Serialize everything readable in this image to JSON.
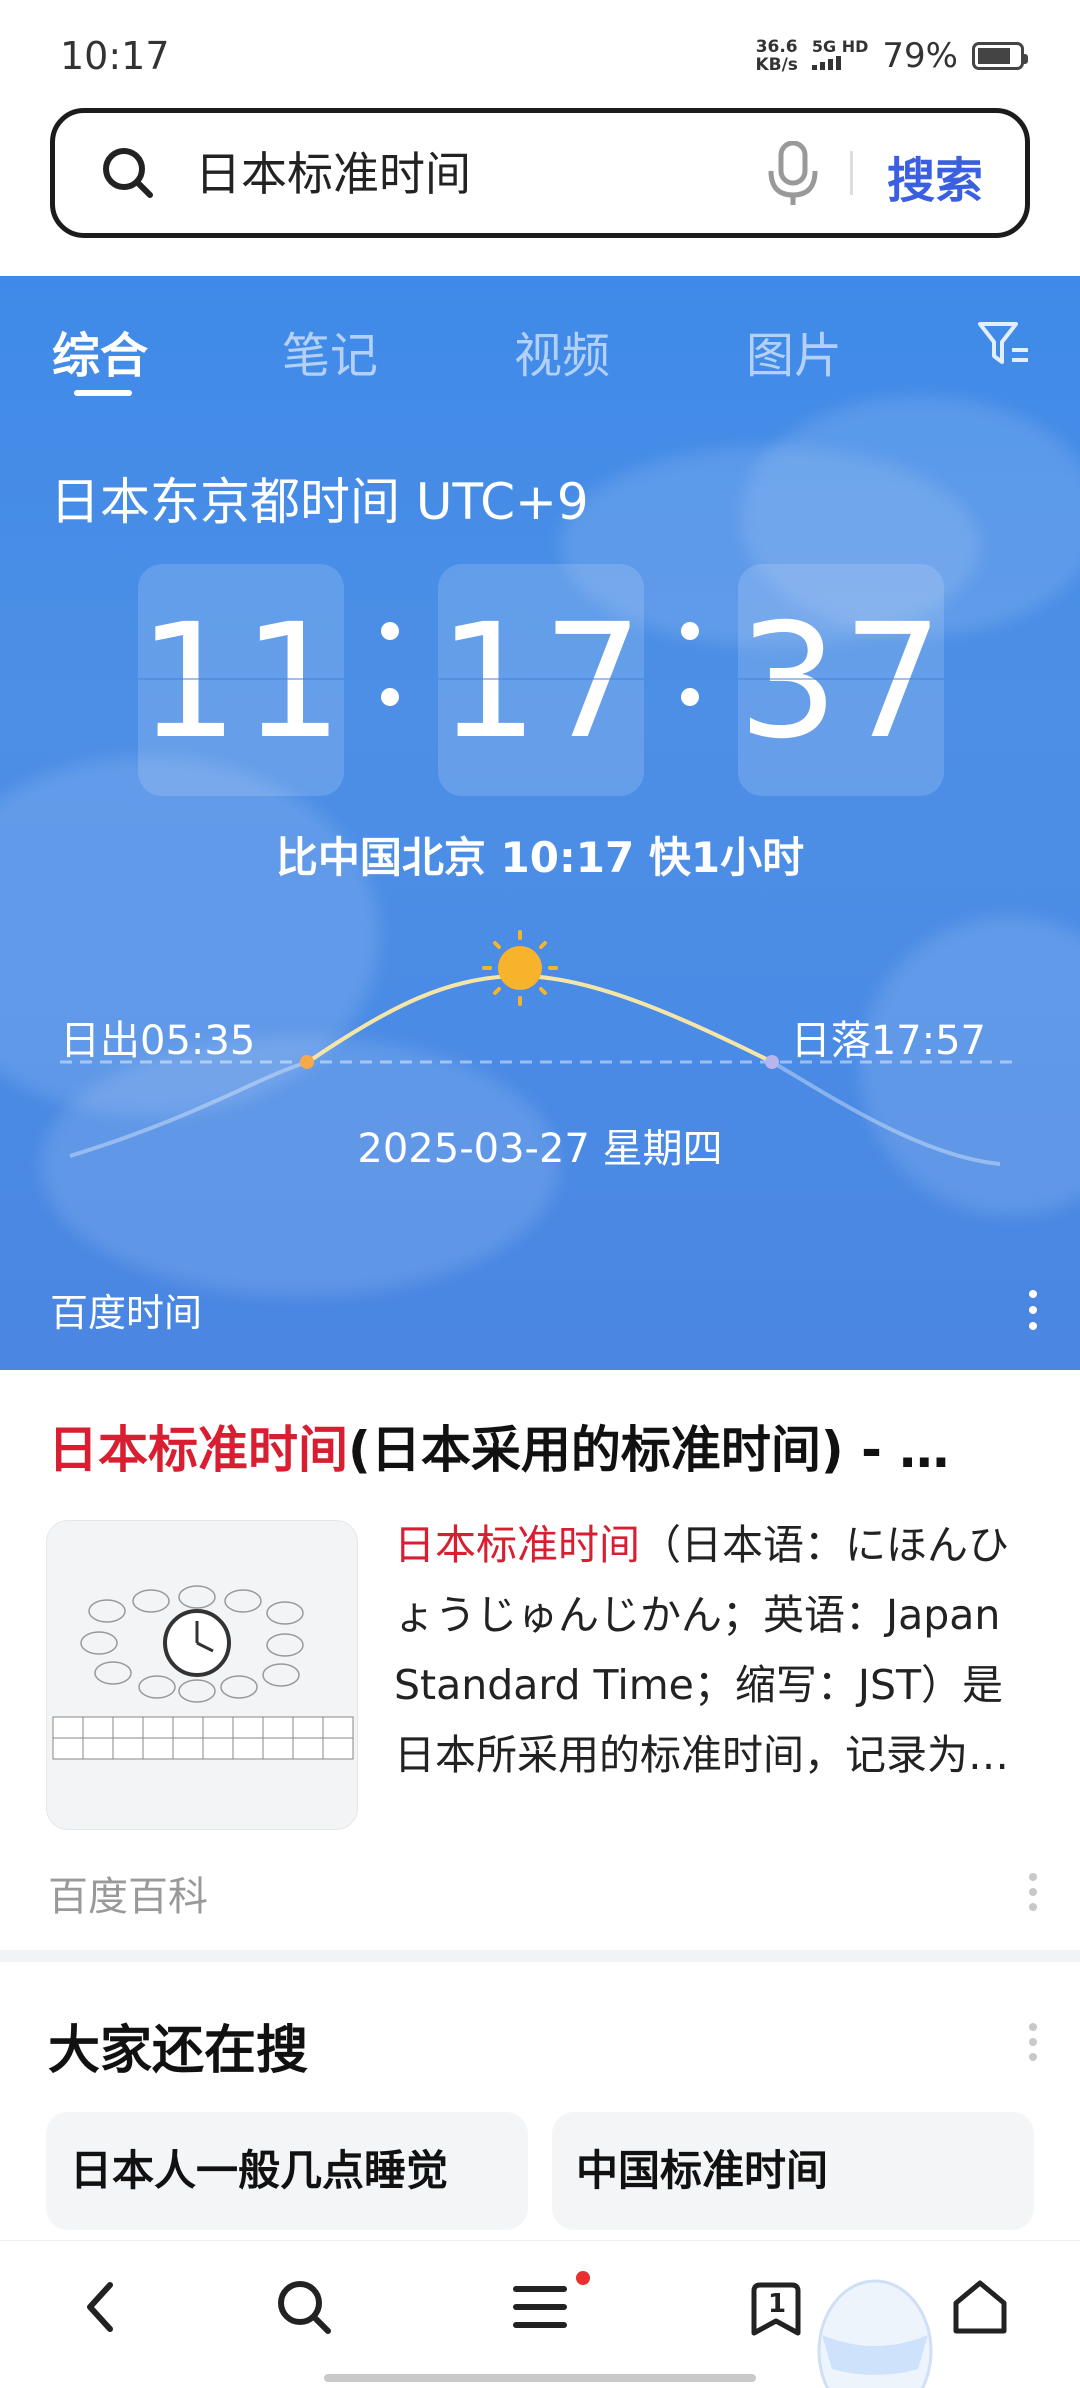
{
  "status": {
    "time": "10:17",
    "net_speed_value": "36.6",
    "net_speed_unit": "KB/s",
    "network": "5G HD",
    "battery_percent": "79%",
    "battery_level": 0.79
  },
  "search": {
    "query": "日本标准时间",
    "button_label": "搜索"
  },
  "tabs": [
    {
      "label": "综合",
      "active": true
    },
    {
      "label": "笔记"
    },
    {
      "label": "视频"
    },
    {
      "label": "图片"
    }
  ],
  "time_card": {
    "zone_title": "日本东京都时间 UTC+9",
    "hours": "11",
    "minutes": "17",
    "seconds": "37",
    "compare_text": "比中国北京 10:17 快1小时",
    "sunrise": "日出05:35",
    "sunset": "日落17:57",
    "date": "2025-03-27  星期四",
    "source": "百度时间"
  },
  "result": {
    "title_highlight": "日本标准时间",
    "title_rest": "(日本采用的标准时间) - …",
    "snippet_highlight": "日本标准时间",
    "snippet_rest": "（日本语：にほんひょうじゅんじかん；英语：Japan Standard Time；缩写：JST）是日本所采用的标准时间，记录为…",
    "source": "百度百科"
  },
  "also_search": {
    "title": "大家还在搜",
    "items": [
      "日本人一般几点睡觉",
      "中国标准时间"
    ]
  },
  "bottom_nav": {
    "tabs_count": "1"
  },
  "colors": {
    "accent_blue": "#3a5fe0",
    "card_blue": "#4a8be5",
    "highlight_red": "#d81e30"
  }
}
